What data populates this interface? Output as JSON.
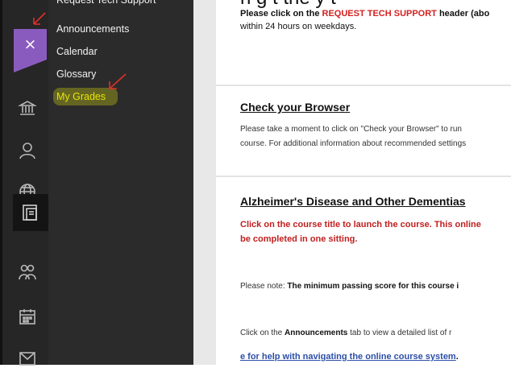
{
  "sidebar": {
    "close_glyph": "×",
    "items": [
      {
        "label": "Request Tech Support"
      },
      {
        "label": "Announcements"
      },
      {
        "label": "Calendar"
      },
      {
        "label": "Glossary"
      },
      {
        "label": "My Grades",
        "highlighted": true
      }
    ],
    "rail_icons": [
      "institution-icon",
      "profile-icon",
      "globe-icon",
      "courses-icon",
      "groups-icon",
      "calendar-icon",
      "messages-icon"
    ]
  },
  "content": {
    "page_title_fragment": "n    g   t   the   y   t",
    "tech_support": {
      "line1_prefix": "Please click on the ",
      "line1_link": "REQUEST TECH SUPPORT",
      "line1_suffix": " header (abo",
      "line2": "within 24 hours on weekdays."
    },
    "browser": {
      "heading": "Check your Browser",
      "line1": "Please take a moment to click on \"Check your Browser\" to run",
      "line2": "course. For additional information about recommended settings"
    },
    "course": {
      "heading": "Alzheimer's Disease and Other Dementias",
      "red_line1": "Click on the course title to launch the course. This online",
      "red_line2": "be completed in one sitting.",
      "note_prefix": "Please note: ",
      "note_bold": "The minimum passing score for this course i",
      "ann_prefix": "Click on the ",
      "ann_bold": "Announcements",
      "ann_suffix": " tab to view a detailed list of r",
      "help_link": "e for help with navigating the online course system",
      "help_period": "."
    }
  },
  "colors": {
    "accent_purple": "#8a5bbf",
    "highlight_yellow": "#e6e600",
    "alert_red": "#c21f1f",
    "link_blue": "#2c4fa8",
    "annotation_red": "#e0302a"
  }
}
